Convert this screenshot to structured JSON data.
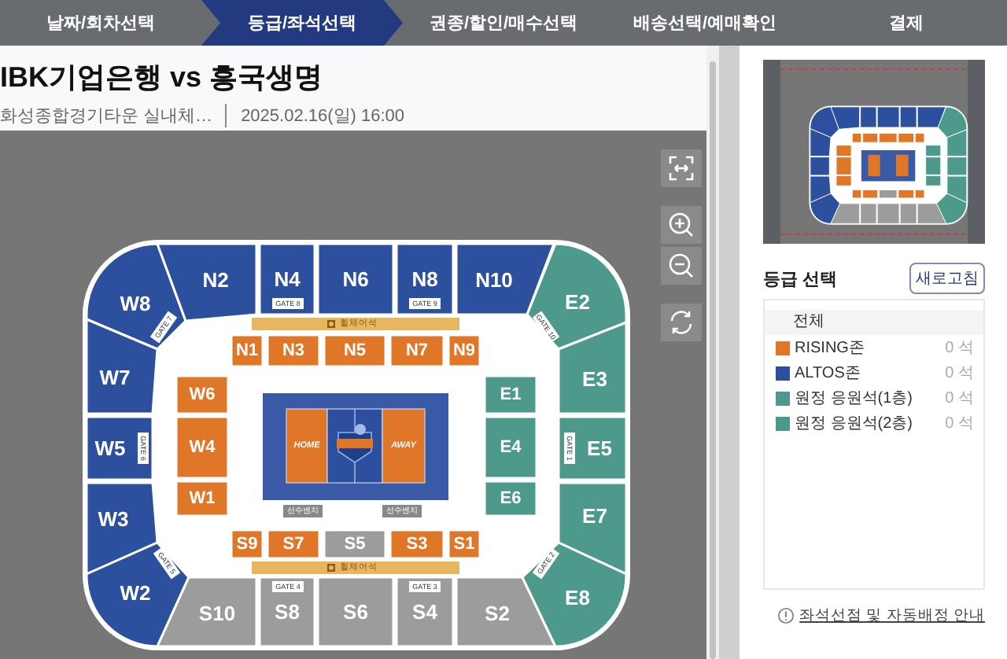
{
  "steps": [
    {
      "label": "날짜/회차선택",
      "selected": false
    },
    {
      "label": "등급/좌석선택",
      "selected": true
    },
    {
      "label": "권종/할인/매수선택",
      "selected": false
    },
    {
      "label": "배송선택/예매확인",
      "selected": false
    },
    {
      "label": "결제",
      "selected": false
    }
  ],
  "event": {
    "title": "IBK기업은행 vs 흥국생명",
    "venue": "화성종합경기타운 실내체…",
    "datetime": "2025.02.16(일) 16:00"
  },
  "seat_map": {
    "sections": [
      {
        "label": "W8",
        "color": "#2c4f9e"
      },
      {
        "label": "N2",
        "color": "#2c4f9e"
      },
      {
        "label": "N4",
        "color": "#2c4f9e"
      },
      {
        "label": "N6",
        "color": "#2c4f9e"
      },
      {
        "label": "N8",
        "color": "#2c4f9e"
      },
      {
        "label": "N10",
        "color": "#2c4f9e"
      },
      {
        "label": "E2",
        "color": "#4d9a8c"
      },
      {
        "label": "W7",
        "color": "#2c4f9e"
      },
      {
        "label": "E3",
        "color": "#4d9a8c"
      },
      {
        "label": "W5",
        "color": "#2c4f9e"
      },
      {
        "label": "E5",
        "color": "#4d9a8c"
      },
      {
        "label": "W3",
        "color": "#2c4f9e"
      },
      {
        "label": "E7",
        "color": "#4d9a8c"
      },
      {
        "label": "W2",
        "color": "#2c4f9e"
      },
      {
        "label": "S10",
        "color": "#9c9c9c"
      },
      {
        "label": "S8",
        "color": "#9c9c9c"
      },
      {
        "label": "S6",
        "color": "#9c9c9c"
      },
      {
        "label": "S4",
        "color": "#9c9c9c"
      },
      {
        "label": "S2",
        "color": "#9c9c9c"
      },
      {
        "label": "E8",
        "color": "#4d9a8c"
      },
      {
        "label": "N1",
        "color": "#e07628"
      },
      {
        "label": "N3",
        "color": "#e07628"
      },
      {
        "label": "N5",
        "color": "#e07628"
      },
      {
        "label": "N7",
        "color": "#e07628"
      },
      {
        "label": "N9",
        "color": "#e07628"
      },
      {
        "label": "W6",
        "color": "#e07628"
      },
      {
        "label": "W4",
        "color": "#e07628"
      },
      {
        "label": "W1",
        "color": "#e07628"
      },
      {
        "label": "E1",
        "color": "#4d9a8c"
      },
      {
        "label": "E4",
        "color": "#4d9a8c"
      },
      {
        "label": "E6",
        "color": "#4d9a8c"
      },
      {
        "label": "S9",
        "color": "#e07628"
      },
      {
        "label": "S7",
        "color": "#e07628"
      },
      {
        "label": "S5",
        "color": "#9c9c9c"
      },
      {
        "label": "S3",
        "color": "#e07628"
      },
      {
        "label": "S1",
        "color": "#e07628"
      }
    ],
    "gates": [
      "GATE 8",
      "GATE 9",
      "GATE 7",
      "GATE 6",
      "GATE 5",
      "GATE 4",
      "GATE 3",
      "GATE 2",
      "GATE 1",
      "GATE 10"
    ],
    "wheelchair": [
      "휠체어석",
      "휠체어석"
    ],
    "benches": [
      "선수벤치",
      "선수벤치"
    ],
    "court": {
      "home": "HOME",
      "away": "AWAY"
    }
  },
  "grade_panel": {
    "title": "등급 선택",
    "refresh_button": "새로고침",
    "all_label": "전체",
    "grades": [
      {
        "name": "RISING존",
        "color": "#e07628",
        "count": "0 석"
      },
      {
        "name": "ALTOS존",
        "color": "#2c4f9e",
        "count": "0 석"
      },
      {
        "name": "원정 응원석(1층)",
        "color": "#4d9a8c",
        "count": "0 석"
      },
      {
        "name": "원정 응원석(2층)",
        "color": "#4d9a8c",
        "count": "0 석"
      }
    ]
  },
  "help_link": "좌석선점 및 자동배정 안내"
}
